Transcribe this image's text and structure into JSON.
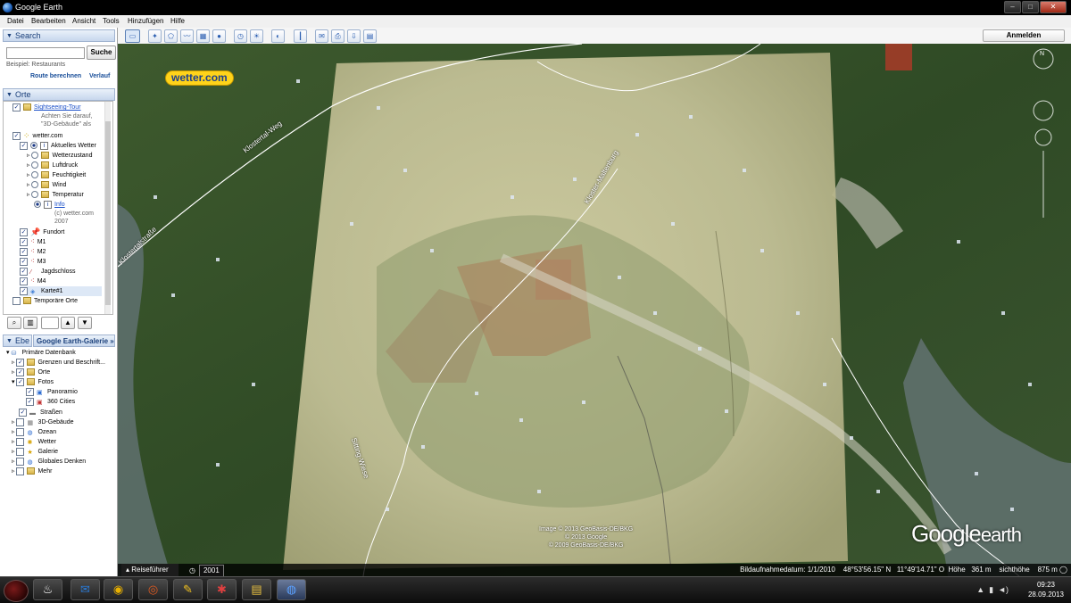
{
  "window": {
    "title": "Google Earth"
  },
  "menu": [
    "Datei",
    "Bearbeiten",
    "Ansicht",
    "Tools",
    "Hinzufügen",
    "Hilfe"
  ],
  "toolbar": {
    "sign_in": "Anmelden"
  },
  "search": {
    "header": "Search",
    "button": "Suche",
    "hint": "Beispiel: Restaurants",
    "route": "Route berechnen",
    "history": "Verlauf"
  },
  "places": {
    "header": "Orte",
    "tour_label": "Sightseeing-Tour",
    "tour_note_1": "Achten Sie darauf,",
    "tour_note_2": "\"3D-Gebäude\" als",
    "wetter": "wetter.com",
    "current_weather": "Aktuelles Wetter",
    "weather_items": [
      "Wetterzustand",
      "Luftdruck",
      "Feuchtigkeit",
      "Wind",
      "Temperatur"
    ],
    "info": "Info",
    "info_note_1": "(c) wetter.com",
    "info_note_2": "2007",
    "items": [
      "Fundort",
      "M1",
      "M2",
      "M3",
      "Jagdschloss",
      "M4",
      "Karte#1"
    ],
    "temp": "Temporäre Orte"
  },
  "layers": {
    "tab_left": "Ebe",
    "tab_right": "Google Earth-Galerie",
    "primary": "Primäre Datenbank",
    "items": [
      "Grenzen und Beschrift...",
      "Orte",
      "Fotos"
    ],
    "photo_items": [
      "Panoramio",
      "360 Cities"
    ],
    "items2": [
      "Straßen",
      "3D-Gebäude",
      "Ozean",
      "Wetter",
      "Galerie",
      "Globales Denken",
      "Mehr"
    ]
  },
  "map": {
    "wetter_logo": "wetter.com",
    "roads": [
      "Klostertal-Weg",
      "Klostertalstraße",
      "Kloster-Maltenburg",
      "Sitting-Wiese"
    ],
    "credit_lines": [
      "Image © 2013 GeoBasis-DE/BKG",
      "© 2013 Google",
      "© 2009 GeoBasis-DE/BKG"
    ],
    "logo_main": "Google",
    "logo_sub": "earth"
  },
  "status": {
    "guide": "Reiseführer",
    "year": "2001",
    "date": "Bildaufnahmedatum: 1/1/2010",
    "lat": "48°53'56.15\" N",
    "lon": "11°49'14.71\" O",
    "elev_label": "Höhe",
    "elev": "361 m",
    "eye_label": "sichthöhe",
    "eye": "875 m"
  },
  "taskbar": {
    "time": "09:23",
    "date": "28.09.2013"
  }
}
